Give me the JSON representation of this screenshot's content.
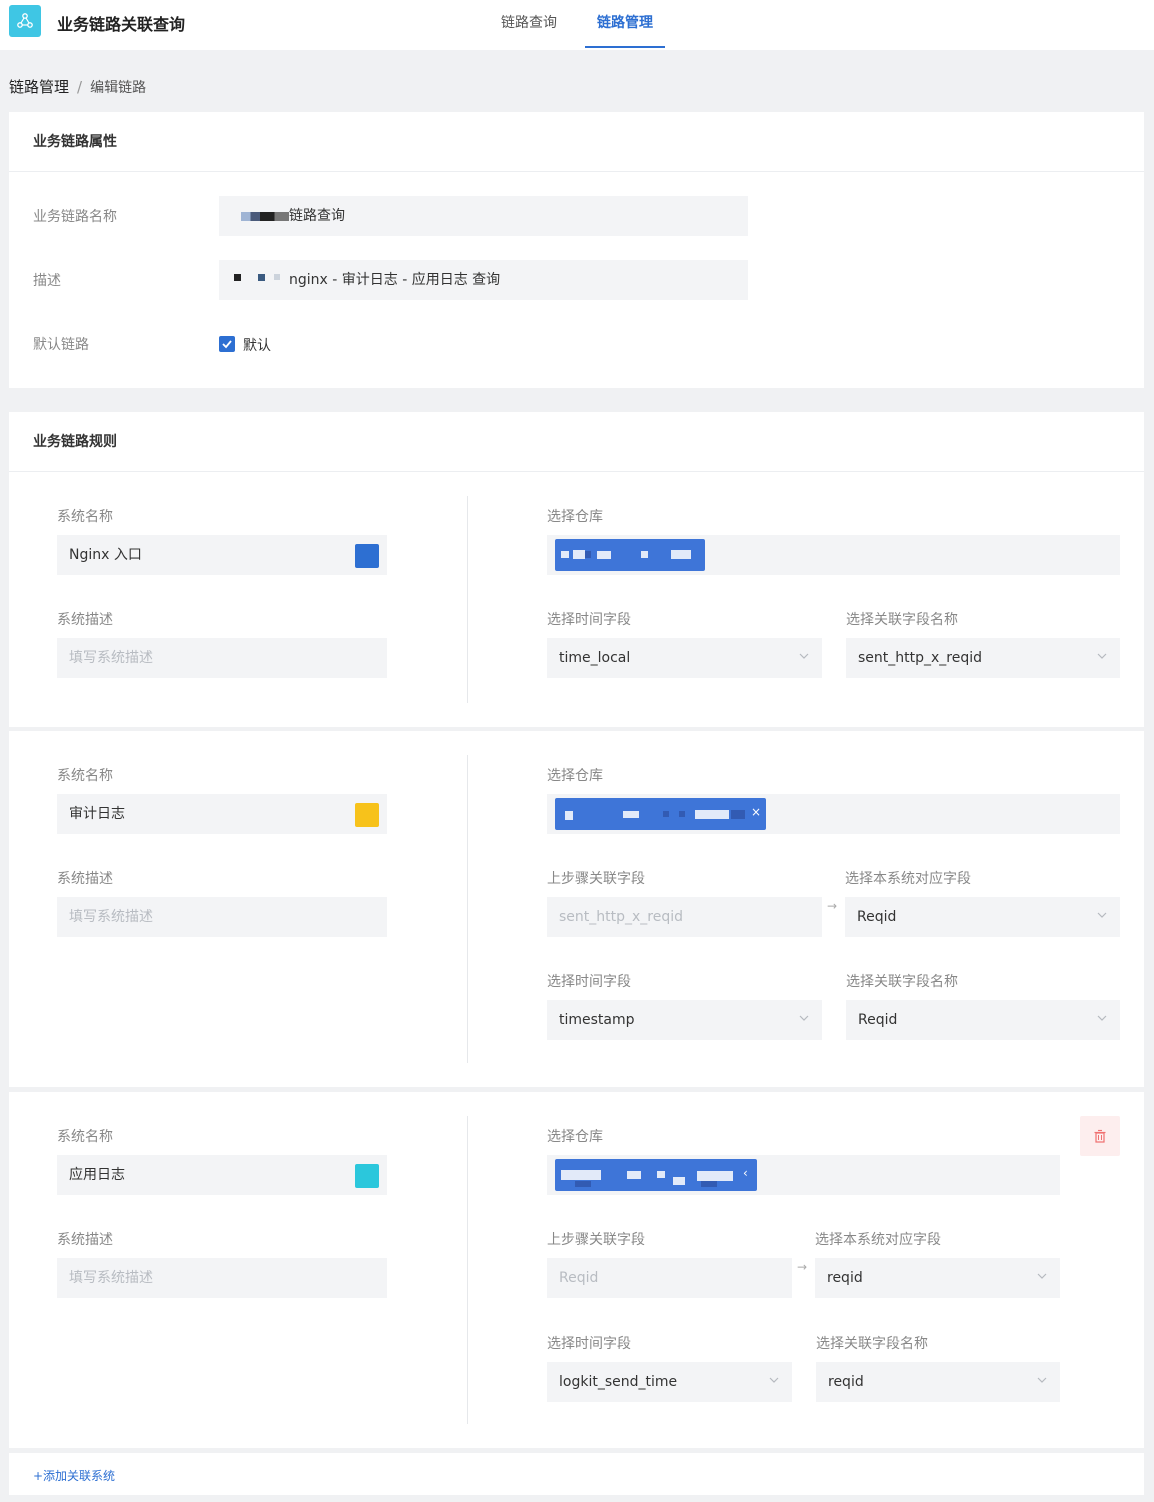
{
  "app": {
    "title": "业务链路关联查询"
  },
  "nav": {
    "tabs": [
      {
        "label": "链路查询"
      },
      {
        "label": "链路管理"
      }
    ]
  },
  "breadcrumb": {
    "root": "链路管理",
    "separator": "/",
    "current": "编辑链路"
  },
  "attributes": {
    "header": "业务链路属性",
    "name_label": "业务链路名称",
    "name_value": "链路查询",
    "desc_label": "描述",
    "desc_value": "nginx - 审计日志  - 应用日志 查询",
    "default_label": "默认链路",
    "default_checkbox_label": "默认"
  },
  "rules": {
    "header": "业务链路规则",
    "systems": [
      {
        "name_label": "系统名称",
        "name_value": "Nginx 入口",
        "color": "#2d6fd2",
        "desc_label": "系统描述",
        "desc_placeholder": "填写系统描述",
        "repo_label": "选择仓库",
        "time_label": "选择时间字段",
        "time_value": "time_local",
        "link_label": "选择关联字段名称",
        "link_value": "sent_http_x_reqid"
      },
      {
        "name_label": "系统名称",
        "name_value": "审计日志",
        "color": "#f7c21b",
        "desc_label": "系统描述",
        "desc_placeholder": "填写系统描述",
        "repo_label": "选择仓库",
        "chip_close": "×",
        "prev_label": "上步骤关联字段",
        "prev_value": "sent_http_x_reqid",
        "own_label": "选择本系统对应字段",
        "own_value": "Reqid",
        "time_label": "选择时间字段",
        "time_value": "timestamp",
        "link_label": "选择关联字段名称",
        "link_value": "Reqid"
      },
      {
        "name_label": "系统名称",
        "name_value": "应用日志",
        "color": "#2bc7dc",
        "desc_label": "系统描述",
        "desc_placeholder": "填写系统描述",
        "repo_label": "选择仓库",
        "chip_close": "‹",
        "prev_label": "上步骤关联字段",
        "prev_value": "Reqid",
        "own_label": "选择本系统对应字段",
        "own_value": "reqid",
        "time_label": "选择时间字段",
        "time_value": "logkit_send_time",
        "link_label": "选择关联字段名称",
        "link_value": "reqid"
      }
    ],
    "arrow": "→",
    "add_label": "+添加关联系统"
  },
  "icons": {
    "logo": "graph-nodes-icon",
    "checkbox": "check-icon",
    "arrow": "chevron-down-icon",
    "delete": "trash-icon"
  }
}
